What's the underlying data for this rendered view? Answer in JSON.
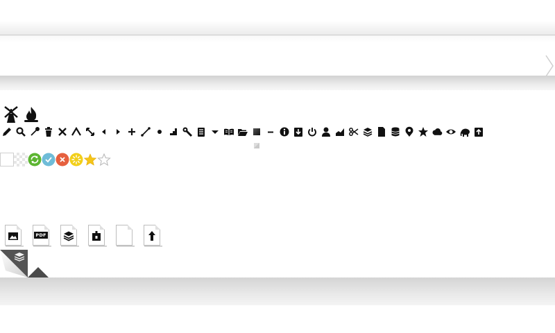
{
  "bands": [
    "top-bar",
    "middle-bar",
    "bottom-bar"
  ],
  "icons": {
    "large": [
      "windmill-icon",
      "fire-icon"
    ],
    "toolbar": [
      "pencil-icon",
      "search-icon",
      "eyedropper-icon",
      "trash-icon",
      "close-icon",
      "triangle-icon",
      "resize-icon",
      "caret-left-icon",
      "caret-right-icon",
      "plus-icon",
      "line-icon",
      "dot-icon",
      "stairs-icon",
      "wrench-icon",
      "document-list-icon",
      "caret-down-icon",
      "open-book-icon",
      "folder-open-icon",
      "gradient-square-icon",
      "minus-icon",
      "info-icon",
      "download-icon",
      "power-icon",
      "user-icon",
      "area-chart-icon",
      "scissors-icon",
      "layers-icon",
      "file-icon",
      "database-icon",
      "map-pin-icon",
      "star-icon",
      "cloud-icon",
      "eye-icon",
      "elephant-icon",
      "upload-file-icon"
    ],
    "status": [
      "blank-box",
      "checker-box",
      "refresh-icon",
      "check-icon",
      "error-icon",
      "loading-icon",
      "star-filled-icon",
      "star-empty-icon"
    ],
    "files": [
      "image-file-icon",
      "pdf-file-icon",
      "layers-file-icon",
      "archive-file-icon",
      "blank-file-icon",
      "upload-arrow-file-icon"
    ]
  },
  "files": {
    "pdf_label": "PDF"
  },
  "colors": {
    "icon": "#111111",
    "refresh": "#5cb531",
    "check": "#6fbcd8",
    "error": "#e6603f",
    "loading": "#f2cf1a",
    "star": "#f5c518",
    "band_shadow": "#d4d4d4"
  }
}
